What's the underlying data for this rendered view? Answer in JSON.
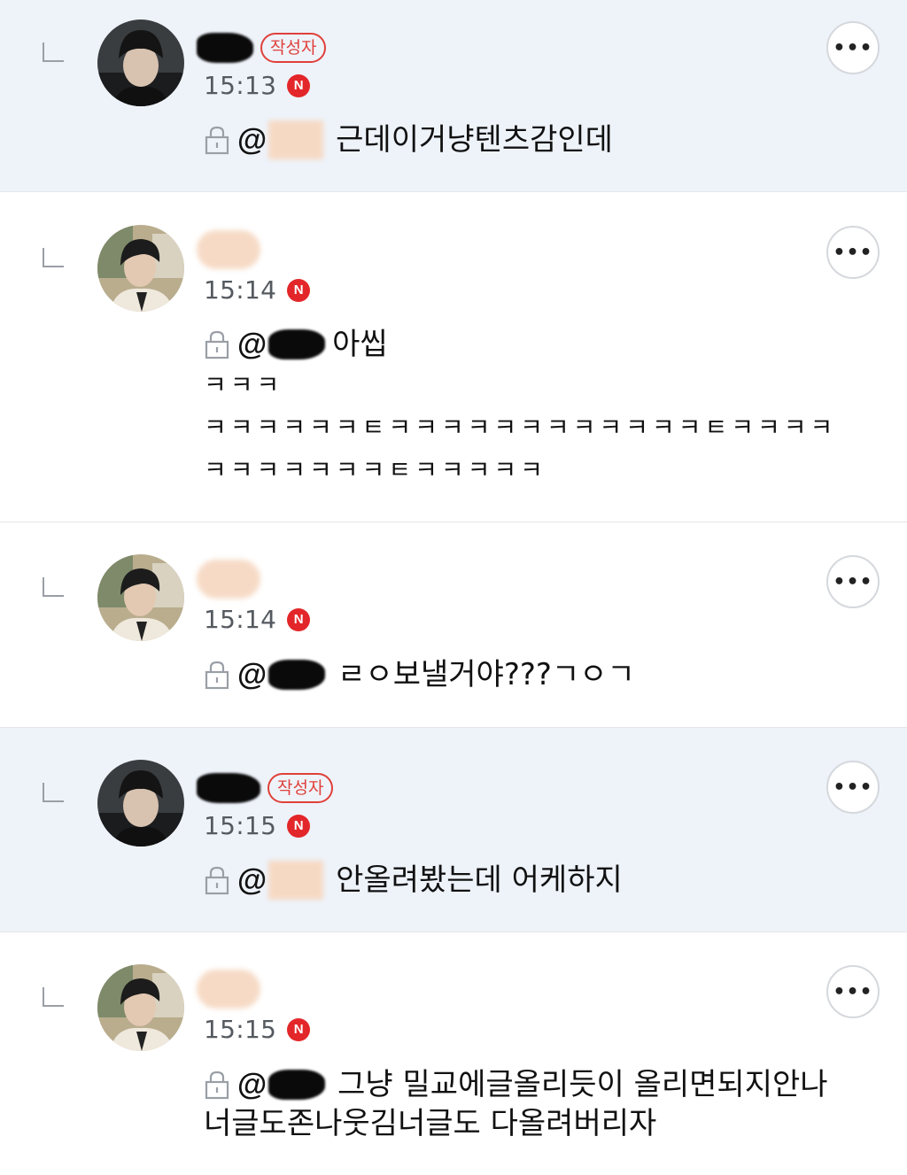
{
  "comments": [
    {
      "author_badge": "작성자",
      "time": "15:13",
      "n_badge": "N",
      "mention_prefix": "@",
      "lines": [
        "근데이거냥텐츠감인데"
      ],
      "more_label": "•••"
    },
    {
      "time": "15:14",
      "n_badge": "N",
      "mention_prefix": "@",
      "lines": [
        "아씹",
        "ㅋㅋㅋ",
        "ㅋㅋㅋㅋㅋㅋㅌㅋㅋㅋㅋㅋㅋㅋㅋㅋㅋㅋㅋㅌㅋㅋㅋㅋ",
        "ㅋㅋㅋㅋㅋㅋㅋㅌㅋㅋㅋㅋㅋ"
      ],
      "more_label": "•••"
    },
    {
      "time": "15:14",
      "n_badge": "N",
      "mention_prefix": "@",
      "lines": [
        "ㄹㅇ보낼거야???ㄱㅇㄱ"
      ],
      "more_label": "•••"
    },
    {
      "author_badge": "작성자",
      "time": "15:15",
      "n_badge": "N",
      "mention_prefix": "@",
      "lines": [
        "안올려봤는데 어케하지"
      ],
      "more_label": "•••"
    },
    {
      "time": "15:15",
      "n_badge": "N",
      "mention_prefix": "@",
      "lines": [
        "그냥 밀교에글올리듯이 올리면되지안나",
        "너글도존나웃김너글도 다올려버리자"
      ],
      "more_label": "•••"
    }
  ],
  "colors": {
    "author_bg": "#eef3fa",
    "badge_red": "#e0403a",
    "n_badge_red": "#e3262a",
    "time_gray": "#555a60"
  },
  "icons": [
    "reply-arrow-icon",
    "lock-icon",
    "n-new-badge-icon",
    "more-options-icon"
  ]
}
